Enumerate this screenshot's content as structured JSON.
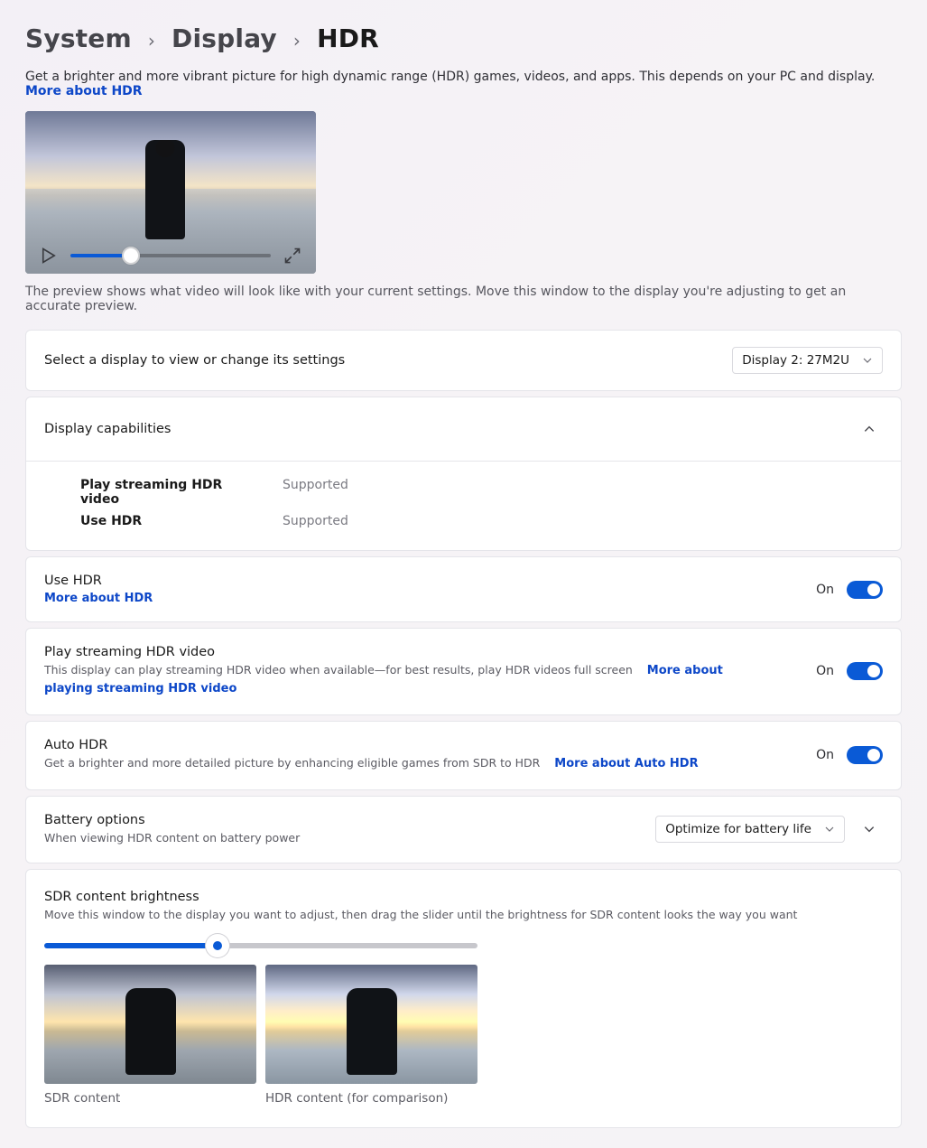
{
  "breadcrumb": {
    "system": "System",
    "display": "Display",
    "hdr": "HDR"
  },
  "intro": {
    "text": "Get a brighter and more vibrant picture for high dynamic range (HDR) games, videos, and apps. This depends on your PC and display.",
    "link": "More about HDR"
  },
  "preview_note": "The preview shows what video will look like with your current settings. Move this window to the display you're adjusting to get an accurate preview.",
  "select_display": {
    "label": "Select a display to view or change its settings",
    "value": "Display 2: 27M2U"
  },
  "capabilities": {
    "heading": "Display capabilities",
    "rows": [
      {
        "key": "Play streaming HDR video",
        "value": "Supported"
      },
      {
        "key": "Use HDR",
        "value": "Supported"
      }
    ]
  },
  "use_hdr": {
    "title": "Use HDR",
    "link": "More about HDR",
    "state": "On"
  },
  "streaming": {
    "title": "Play streaming HDR video",
    "sub": "This display can play streaming HDR video when available—for best results, play HDR videos full screen",
    "link": "More about playing streaming HDR video",
    "state": "On"
  },
  "autohdr": {
    "title": "Auto HDR",
    "sub": "Get a brighter and more detailed picture by enhancing eligible games from SDR to HDR",
    "link": "More about Auto HDR",
    "state": "On"
  },
  "battery": {
    "title": "Battery options",
    "sub": "When viewing HDR content on battery power",
    "value": "Optimize for battery life"
  },
  "sdr": {
    "title": "SDR content brightness",
    "sub": "Move this window to the display you want to adjust, then drag the slider until the brightness for SDR content looks the way you want",
    "sdr_label": "SDR content",
    "hdr_label": "HDR content (for comparison)"
  }
}
